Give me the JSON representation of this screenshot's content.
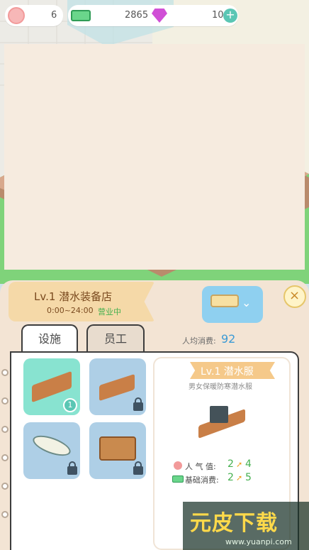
{
  "hud": {
    "shell_count": "6",
    "cash_amount": "2865",
    "gem_count": "10",
    "plus_icon": "plus-icon"
  },
  "shop": {
    "title": "Lv.1 潜水装备店",
    "hours": "0:00~24:00",
    "status": "营业中"
  },
  "tabs": {
    "facility": "设施",
    "staff": "员工"
  },
  "avg_spend": {
    "label": "人均消费:",
    "value": "92"
  },
  "slots": {
    "slot1_level": "1"
  },
  "detail": {
    "title": "Lv.1 潜水服",
    "description": "男女保暖防寒潜水服",
    "popularity_label": "人 气 值:",
    "popularity_from": "2",
    "popularity_to": "4",
    "base_spend_label": "基础消费:",
    "base_spend_from": "2",
    "base_spend_to": "5"
  },
  "watermark": {
    "brand": "元皮下载",
    "url": "www.yuanpi.com"
  },
  "colors": {
    "accent_green": "#45b04f",
    "accent_blue": "#3b9ad5",
    "banner": "#f5d9a8",
    "selected_slot": "#88e3d0"
  }
}
